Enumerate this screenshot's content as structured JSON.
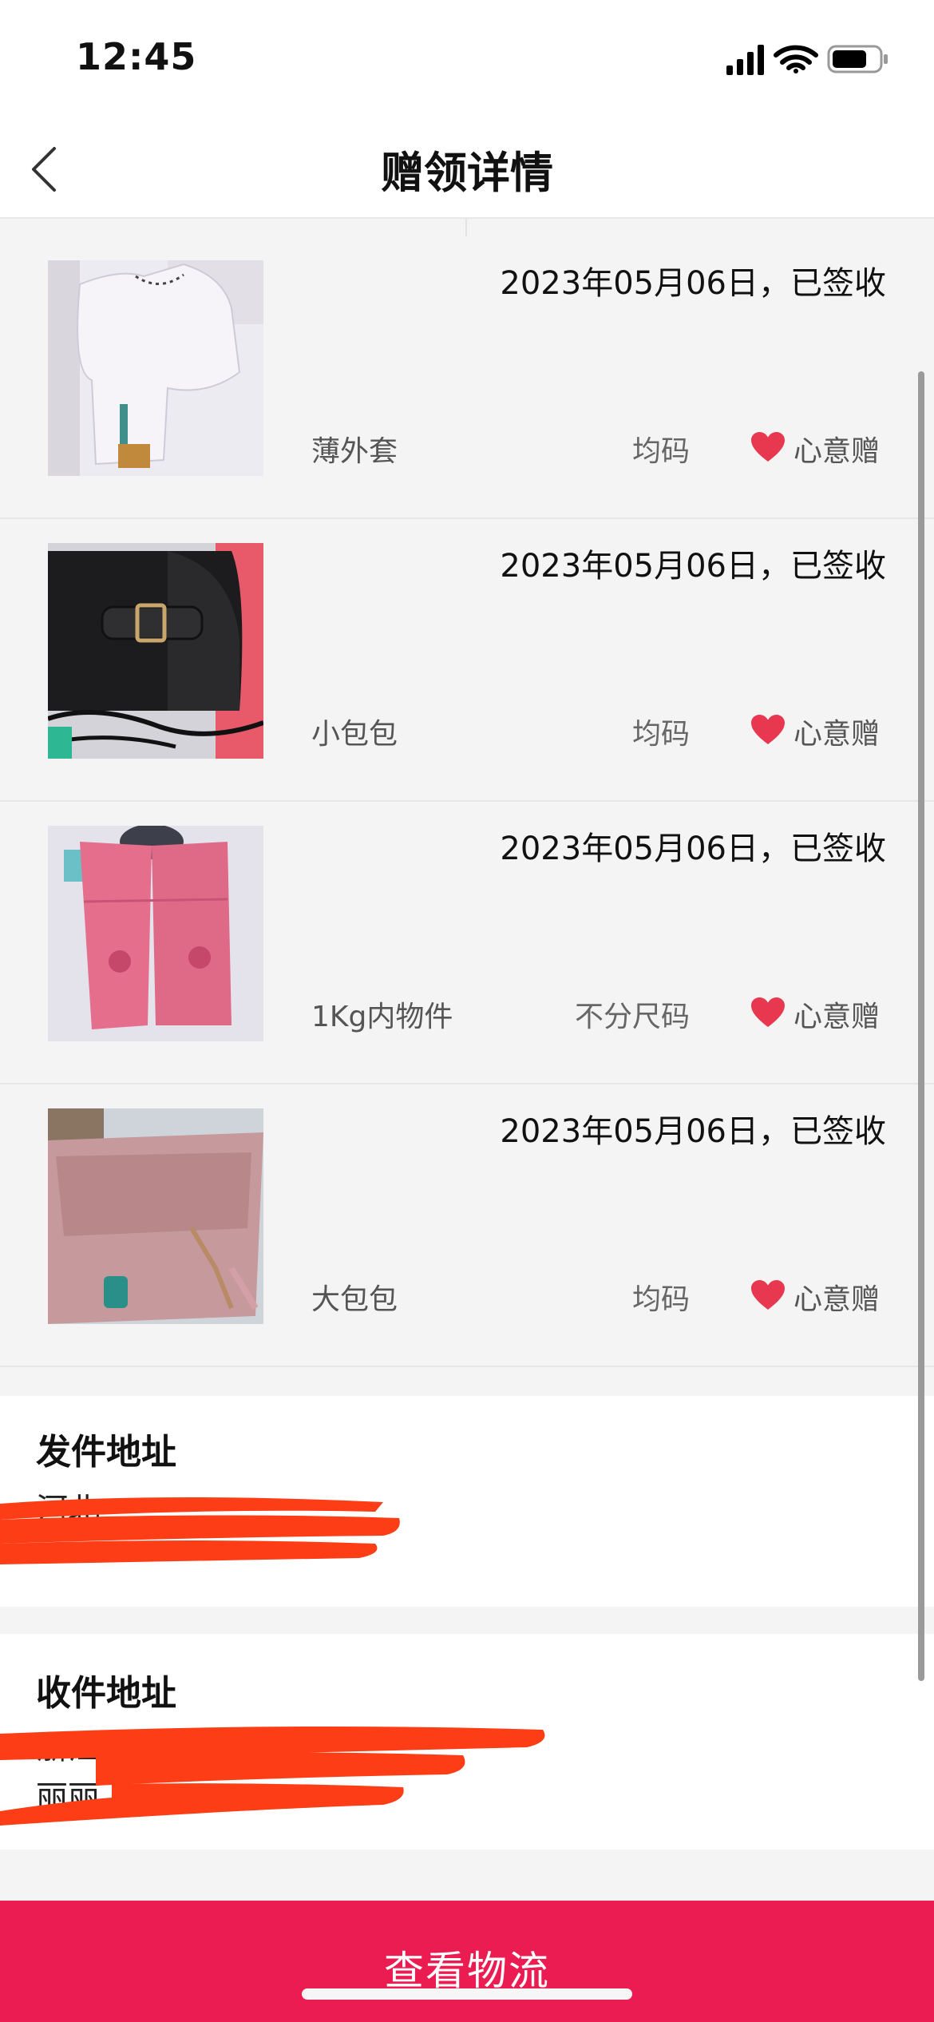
{
  "status_bar": {
    "time": "12:45"
  },
  "header": {
    "title": "赠领详情"
  },
  "items": [
    {
      "date": "2023年05月06日，已签收",
      "name": "薄外套",
      "size": "均码",
      "tag": "心意赠"
    },
    {
      "date": "2023年05月06日，已签收",
      "name": "小包包",
      "size": "均码",
      "tag": "心意赠"
    },
    {
      "date": "2023年05月06日，已签收",
      "name": "1Kg内物件",
      "size": "不分尺码",
      "tag": "心意赠"
    },
    {
      "date": "2023年05月06日，已签收",
      "name": "大包包",
      "size": "均码",
      "tag": "心意赠"
    }
  ],
  "sender": {
    "title": "发件地址",
    "line1": "河北",
    "line2": ""
  },
  "receiver": {
    "title": "收件地址",
    "line1": "浙江",
    "line2": "丽丽 17621"
  },
  "footer": {
    "button_label": "查看物流"
  },
  "colors": {
    "accent": "#ea1c51",
    "heart": "#e8384f",
    "redaction": "#fc3d16"
  }
}
